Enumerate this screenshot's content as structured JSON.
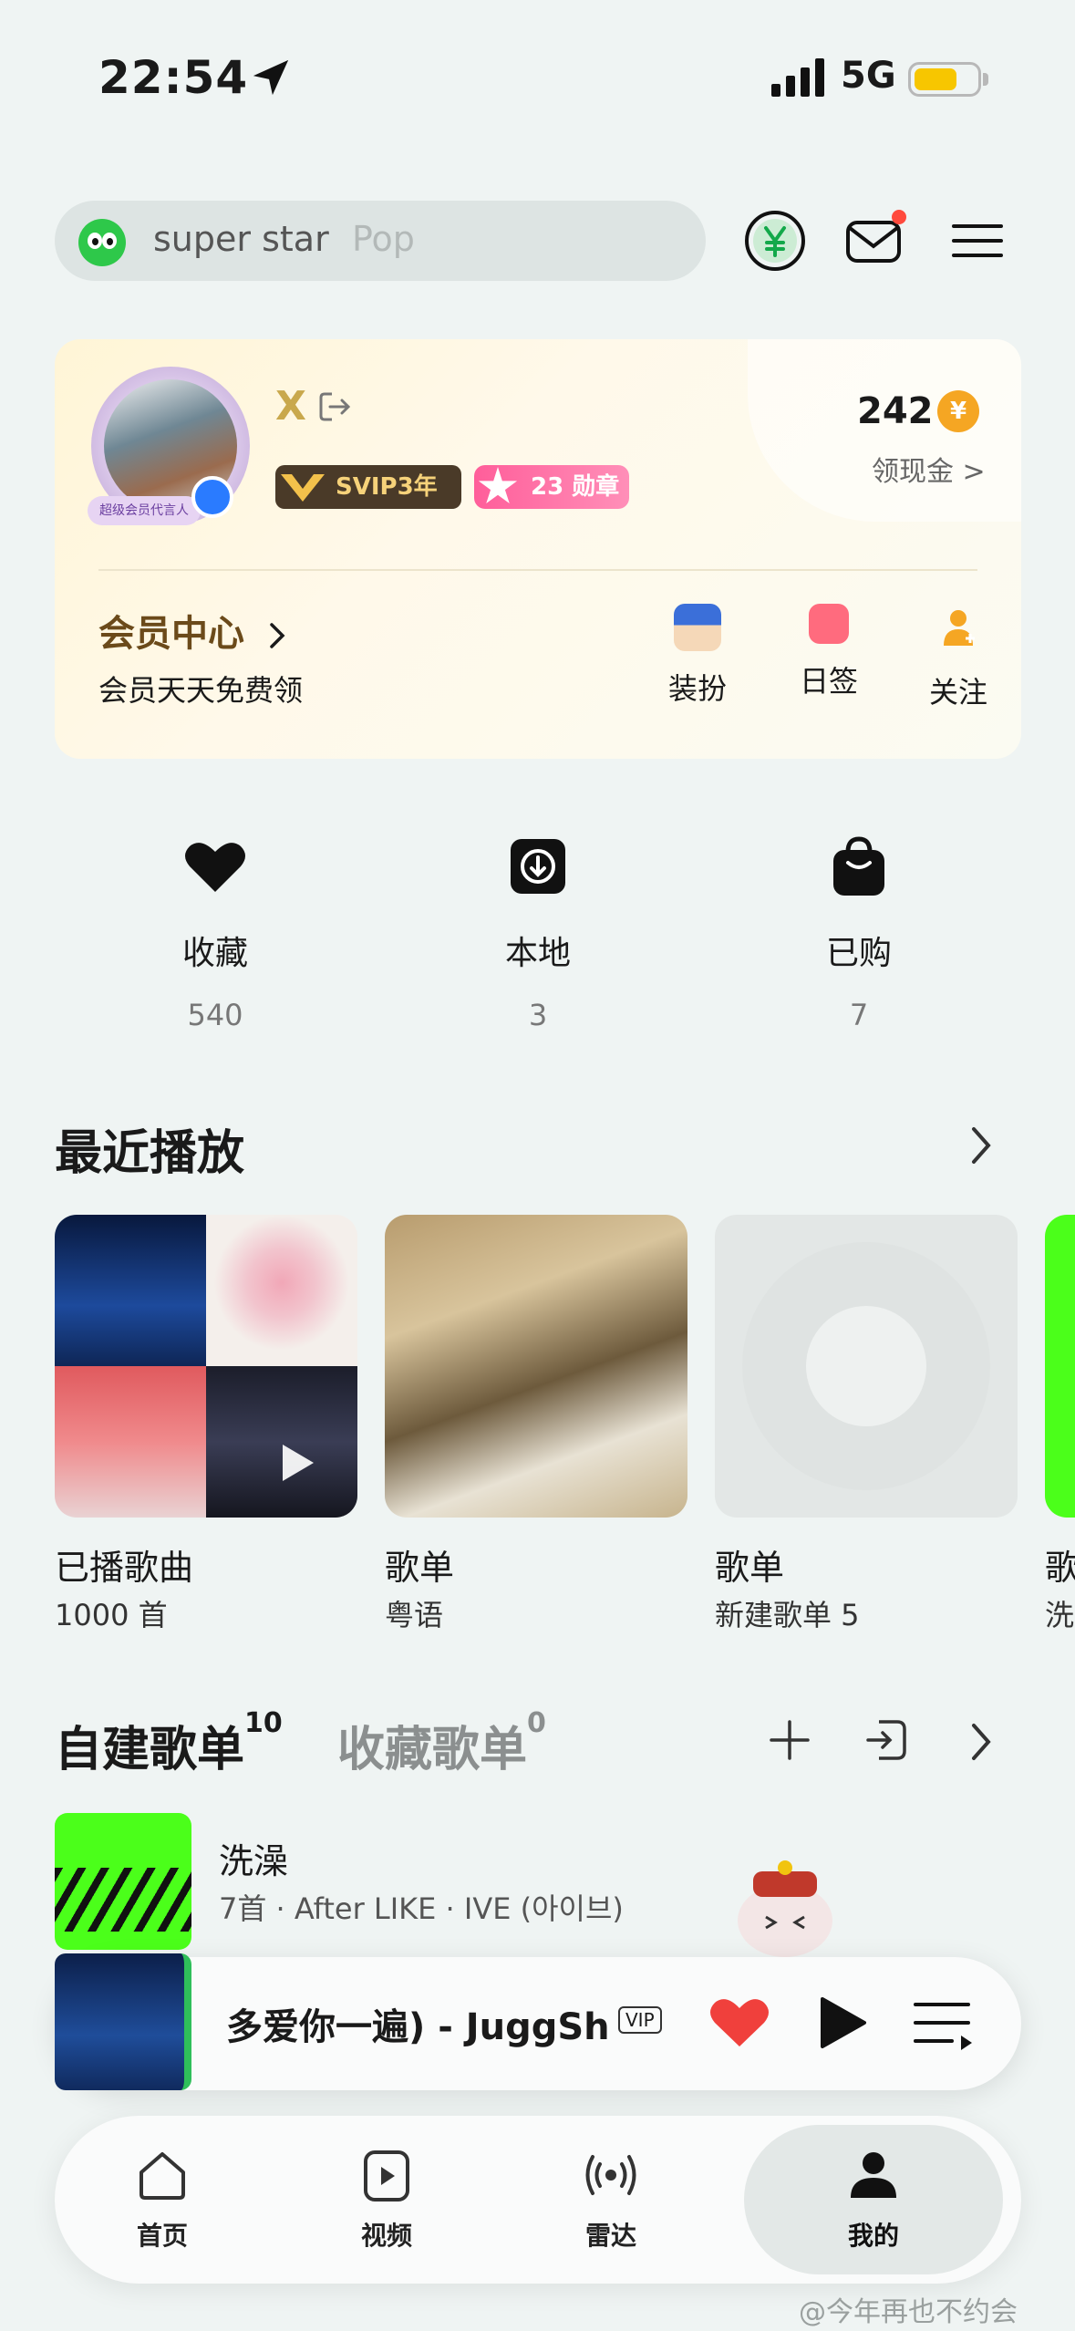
{
  "status": {
    "time": "22:54",
    "network": "5G"
  },
  "search": {
    "value": "super star",
    "hint": "Pop"
  },
  "member_card": {
    "user_name": "X",
    "avatar_tag": "超级会员代言人",
    "svip_label": "SVIP3年",
    "medal_label": "23 勋章",
    "coin_count": "242",
    "coin_symbol": "¥",
    "coin_link": "领现金 >",
    "vip_center": "会员中心",
    "vip_sub": "会员天天免费领",
    "actions": [
      {
        "label": "装扮"
      },
      {
        "label": "日签"
      },
      {
        "label": "关注"
      }
    ]
  },
  "stats": [
    {
      "label": "收藏",
      "count": "540"
    },
    {
      "label": "本地",
      "count": "3"
    },
    {
      "label": "已购",
      "count": "7"
    }
  ],
  "recent": {
    "title": "最近播放",
    "items": [
      {
        "caption": "已播歌曲",
        "sub": "1000 首"
      },
      {
        "caption": "歌单",
        "sub": "粤语"
      },
      {
        "caption": "歌单",
        "sub": "新建歌单 5"
      },
      {
        "caption": "歌",
        "sub": "洗"
      }
    ]
  },
  "playlists": {
    "tab_created": "自建歌单",
    "tab_created_count": "10",
    "tab_collected": "收藏歌单",
    "tab_collected_count": "0",
    "items": [
      {
        "title": "洗澡",
        "meta": "7首 · After LIKE · IVE (아이브)"
      }
    ]
  },
  "player": {
    "title": "多爱你一遍) - JuggSh",
    "vip_tag": "VIP"
  },
  "nav": [
    {
      "label": "首页"
    },
    {
      "label": "视频"
    },
    {
      "label": "雷达"
    },
    {
      "label": "我的"
    }
  ],
  "watermark": "@今年再也不约会",
  "colors": {
    "accent_green": "#2ec84a",
    "vip_brown": "#6b4a1a",
    "heart_red": "#f0403c",
    "coin_orange": "#f5a623"
  }
}
